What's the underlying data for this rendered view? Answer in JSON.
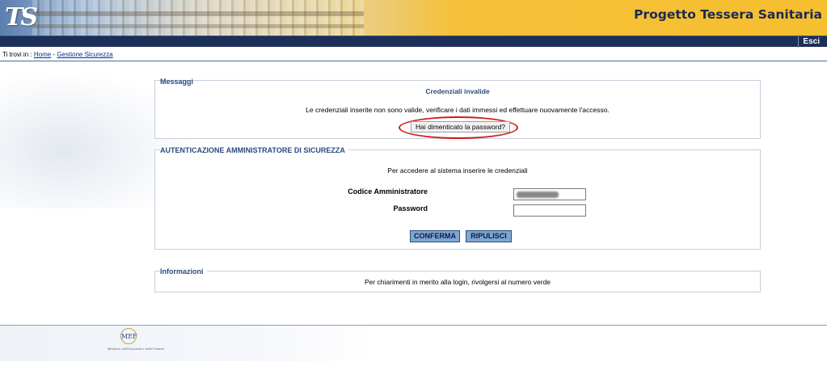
{
  "header": {
    "logo_text": "TS",
    "app_title": "Progetto Tessera Sanitaria",
    "exit_label": "Esci"
  },
  "breadcrumb": {
    "prefix": "Ti trovi in :",
    "items": [
      "Home",
      "Gestione Sicurezza"
    ],
    "separator": "-"
  },
  "messages": {
    "title": "Messaggi",
    "heading": "Credenziali invalide",
    "text": "Le credenziali inserite non sono valide, verificare i dati immessi ed effettuare nuovamente l'accesso.",
    "forgot_button": "Hai dimenticato la password?"
  },
  "auth": {
    "title": "AUTENTICAZIONE AMMINISTRATORE DI SICUREZZA",
    "instructions": "Per accedere al sistema inserire le credenziali",
    "code_label": "Codice Amministratore",
    "password_label": "Password",
    "confirm_button": "CONFERMA",
    "reset_button": "RIPULISCI"
  },
  "info": {
    "title": "Informazioni",
    "text": "Per chiarimenti in merito alla login, rivolgersi al numero verde"
  },
  "footer": {
    "logo_text": "MEF",
    "caption": "Ministero dell'Economia e delle Finanze"
  },
  "colors": {
    "accent": "#2b4a7e",
    "navbar": "#1c2f57",
    "header_gold": "#f6bf2f",
    "highlight_circle": "#d21b1b",
    "button": "#7ea6cf"
  }
}
